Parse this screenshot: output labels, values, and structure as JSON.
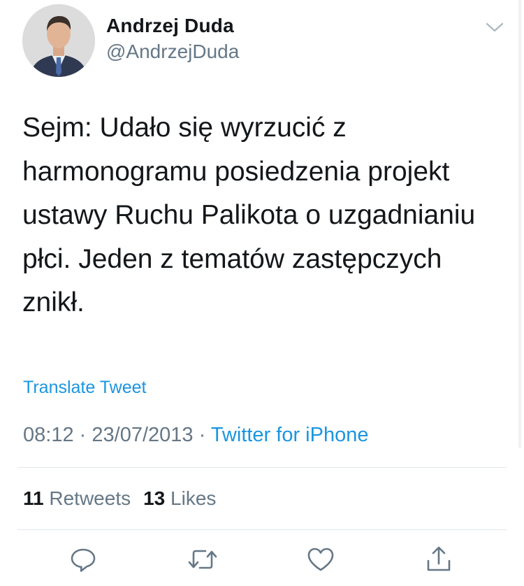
{
  "user": {
    "display_name": "Andrzej Duda",
    "handle": "@AndrzejDuda"
  },
  "tweet": {
    "text": "Sejm: Udało się wyrzucić z\nharmonogramu posiedzenia projekt\nustawy Ruchu Palikota o uzgadnianiu\npłci. Jeden z tematów zastępczych\nznikł.",
    "translate_label": "Translate Tweet",
    "time": "08:12",
    "separator": "·",
    "date": "23/07/2013",
    "source": "Twitter for iPhone"
  },
  "stats": {
    "retweets_count": "11",
    "retweets_label": "Retweets",
    "likes_count": "13",
    "likes_label": "Likes"
  },
  "actions": {
    "reply": "reply-icon",
    "retweet": "retweet-icon",
    "like": "heart-icon",
    "share": "share-icon"
  },
  "colors": {
    "link": "#1b95e0",
    "secondary": "#657786",
    "primary_text": "#14171a",
    "divider": "#e1e8ed"
  }
}
